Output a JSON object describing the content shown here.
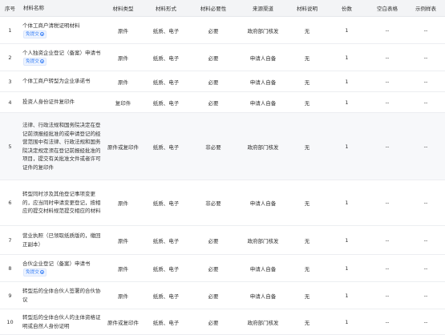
{
  "headers": [
    "序号",
    "材料名称",
    "材料类型",
    "材料形式",
    "材料必要性",
    "来源渠道",
    "材料说明",
    "份数",
    "空白表格",
    "示例样表"
  ],
  "exempt_label": "免提交",
  "rows": [
    {
      "no": "1",
      "name": "个体工商户清税证明材料",
      "badge": true,
      "type": "原件",
      "form": "纸质、电子",
      "necessity": "必要",
      "source": "政府部门核发",
      "note": "无",
      "copies": "1",
      "blank": "--",
      "sample": "--"
    },
    {
      "no": "2",
      "name": "个人独资企业登记（备案）申请书",
      "badge": true,
      "type": "原件",
      "form": "纸质、电子",
      "necessity": "必要",
      "source": "申请人自备",
      "note": "无",
      "copies": "1",
      "blank": "--",
      "sample": "--"
    },
    {
      "no": "3",
      "name": "个体工商户转型为企业承诺书",
      "badge": false,
      "type": "原件",
      "form": "纸质、电子",
      "necessity": "必要",
      "source": "申请人自备",
      "note": "无",
      "copies": "1",
      "blank": "--",
      "sample": "--"
    },
    {
      "no": "4",
      "name": "投资人身份证件复印件",
      "badge": false,
      "type": "复印件",
      "form": "纸质、电子",
      "necessity": "必要",
      "source": "申请人自备",
      "note": "无",
      "copies": "1",
      "blank": "--",
      "sample": "--"
    },
    {
      "no": "5",
      "name": "法律、行政法规和国务院决定在登记前须报经批准的或申请登记的经营范围中有法律、行政法规和国务院决定规定须在登记前报经批准的项目，提交有关批准文件或者许可证件的复印件",
      "badge": false,
      "type": "原件或复印件",
      "form": "纸质、电子",
      "necessity": "非必要",
      "source": "政府部门核发",
      "note": "无",
      "copies": "1",
      "blank": "--",
      "sample": "--"
    },
    {
      "no": "6",
      "name": "转型同时涉及其他登记事项变更的，应当同时申请变更登记，按相应的提交材料规范提交相应的材料",
      "badge": false,
      "type": "原件",
      "form": "纸质、电子",
      "necessity": "非必要",
      "source": "申请人自备",
      "note": "无",
      "copies": "1",
      "blank": "--",
      "sample": "--"
    },
    {
      "no": "7",
      "name": "营业执照（已领取纸质版的，缴回正副本）",
      "badge": false,
      "type": "原件",
      "form": "纸质、电子",
      "necessity": "必要",
      "source": "政府部门核发",
      "note": "无",
      "copies": "1",
      "blank": "--",
      "sample": "--"
    },
    {
      "no": "8",
      "name": "合伙企业登记（备案）申请书",
      "badge": true,
      "type": "原件",
      "form": "纸质、电子",
      "necessity": "必要",
      "source": "申请人自备",
      "note": "无",
      "copies": "1",
      "blank": "--",
      "sample": "--"
    },
    {
      "no": "9",
      "name": "转型后的全体合伙人签署的合伙协议",
      "badge": false,
      "type": "原件",
      "form": "纸质、电子",
      "necessity": "必要",
      "source": "申请人自备",
      "note": "无",
      "copies": "1",
      "blank": "--",
      "sample": "--"
    },
    {
      "no": "10",
      "name": "转型后的全体合伙人的主体资格证明或自然人身份证明",
      "badge": false,
      "type": "原件或复印件",
      "form": "纸质、电子",
      "necessity": "必要",
      "source": "政府部门核发",
      "note": "无",
      "copies": "1",
      "blank": "--",
      "sample": "--"
    }
  ]
}
